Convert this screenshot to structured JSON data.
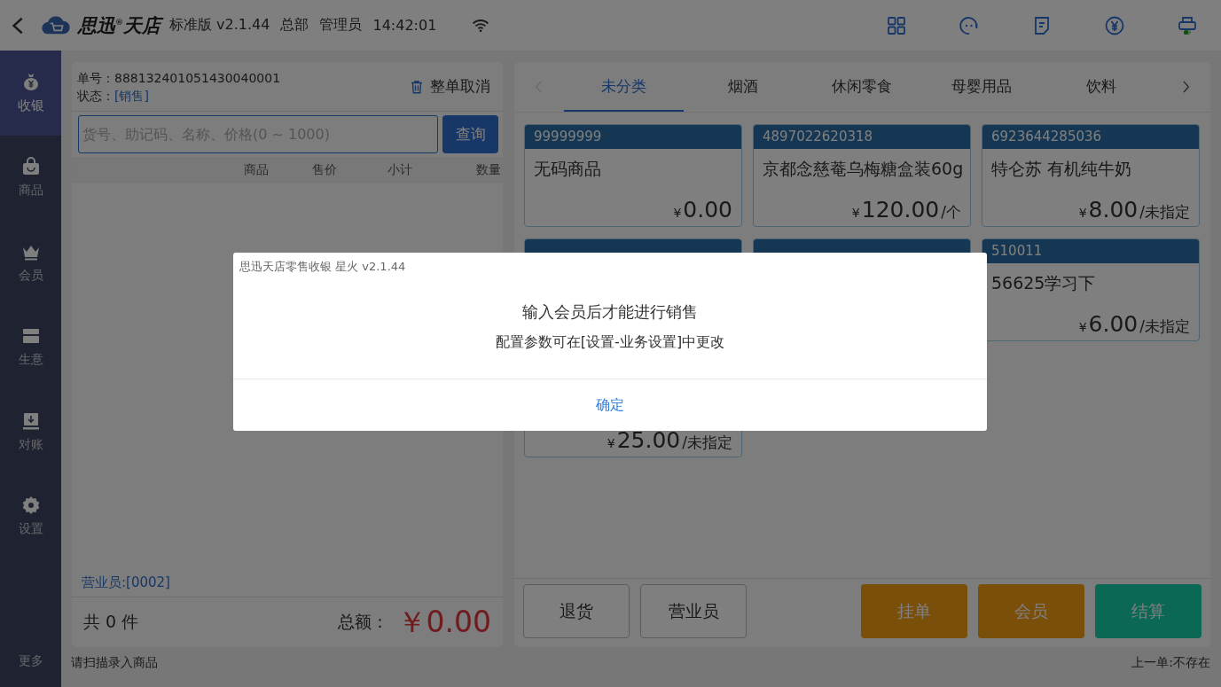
{
  "top_bar": {
    "logo": "思迅$^{®}$天店",
    "edition": "标准版 v2.1.44",
    "branch": "总部",
    "role": "管理员",
    "time": "14:42:01"
  },
  "sidebar": {
    "items": [
      {
        "label": "收银",
        "selected": true
      },
      {
        "label": "商品",
        "selected": false
      },
      {
        "label": "会员",
        "selected": false
      },
      {
        "label": "生意",
        "selected": false
      },
      {
        "label": "对账",
        "selected": false
      },
      {
        "label": "设置",
        "selected": false
      }
    ],
    "more": "更多"
  },
  "order": {
    "number_label": "单号：",
    "number": "888132401051430040001",
    "status_label": "状态：",
    "status": "[销售]",
    "cancel_button": "整单取消",
    "search": {
      "placeholder": "货号、助记码、名称、价格(0 ~ 1000)"
    },
    "query_button": "查询",
    "columns": [
      "商品",
      "售价",
      "小计",
      "数量"
    ],
    "salesperson": "营业员:[0002]",
    "count": "共 0 件",
    "total_label": "总额：",
    "total": "￥0.00"
  },
  "categories": {
    "prev_disabled": true,
    "next_disabled": false,
    "tabs": [
      {
        "label": "未分类",
        "selected": true
      },
      {
        "label": "烟酒",
        "selected": false
      },
      {
        "label": "休闲零食",
        "selected": false
      },
      {
        "label": "母婴用品",
        "selected": false
      },
      {
        "label": "饮料",
        "selected": false
      }
    ]
  },
  "products": [
    {
      "kind": "card",
      "code": "99999999",
      "name": "无码商品",
      "currency": "¥",
      "price": "0.00"
    },
    {
      "kind": "card",
      "code": "4897022620318",
      "name": "京都念慈菴乌梅糖盒装60g",
      "currency": "¥",
      "price": "120.00",
      "unit": "/个"
    },
    {
      "kind": "card",
      "code": "6923644285036",
      "name": "特仑苏 有机纯牛奶",
      "currency": "¥",
      "price": "8.00",
      "unit": "/未指定"
    },
    {
      "kind": "tall",
      "currency": "¥",
      "price": "25.00",
      "unit": "/未指定"
    },
    {
      "kind": "stub"
    },
    {
      "kind": "card",
      "code": "510011",
      "name": "56625学习下",
      "currency": "¥",
      "price": "6.00",
      "unit": "/未指定"
    }
  ],
  "actions": [
    {
      "label": "退货",
      "kind": "outline"
    },
    {
      "label": "营业员",
      "kind": "outline"
    },
    {
      "label": "挂单",
      "kind": "warning"
    },
    {
      "label": "会员",
      "kind": "warning"
    },
    {
      "label": "结算",
      "kind": "primary"
    }
  ],
  "status_bar": {
    "hint": "请扫描录入商品",
    "last_order": "上一单:不存在"
  },
  "dialog": {
    "title": "思迅天店零售收银 星火 v2.1.44",
    "message": "输入会员后才能进行销售",
    "note": "配置参数可在[设置-业务设置]中更改",
    "ok_button": "确定"
  }
}
